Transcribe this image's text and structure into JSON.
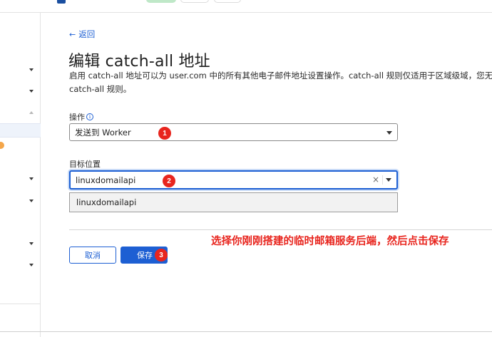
{
  "nav": {
    "back_label": "返回"
  },
  "page": {
    "title": "编辑 catch-all 地址",
    "description_line1": "启用 catch-all 地址可以为 user.com 中的所有其他电子邮件地址设置操作。catch-all 规则仅适用于区域级域，您无法",
    "description_line2": "catch-all 规则。"
  },
  "form": {
    "action": {
      "label": "操作",
      "value": "发送到 Worker"
    },
    "destination": {
      "label": "目标位置",
      "value": "linuxdomailapi",
      "clear_symbol": "×",
      "options": [
        "linuxdomailapi"
      ]
    }
  },
  "buttons": {
    "cancel_label": "取消",
    "save_label": "保存"
  },
  "annotations": {
    "marker1": "1",
    "marker2": "2",
    "marker3": "3",
    "note": "选择你刚刚搭建的临时邮箱服务后端，然后点击保存"
  },
  "colors": {
    "accent": "#1d5fd3",
    "annotation_red": "#e8251e"
  }
}
